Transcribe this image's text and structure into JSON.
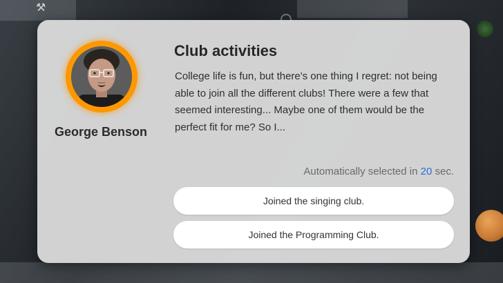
{
  "dialog": {
    "npc_name": "George Benson",
    "title": "Club activities",
    "body": "College life is fun, but there's one thing I regret: not being able to join all the different clubs! There were a few that seemed interesting... Maybe one of them would be the perfect fit for me? So I...",
    "timer": {
      "prefix": "Automatically selected in ",
      "seconds": "20",
      "suffix": " sec."
    },
    "choices": [
      {
        "label": "Joined the singing club."
      },
      {
        "label": "Joined the Programming Club."
      }
    ]
  },
  "colors": {
    "avatar_ring": "#ff9a00",
    "timer_accent": "#2a6fd6",
    "dialog_bg": "#dadada"
  },
  "icons": {
    "background_tool": "tools-icon"
  }
}
